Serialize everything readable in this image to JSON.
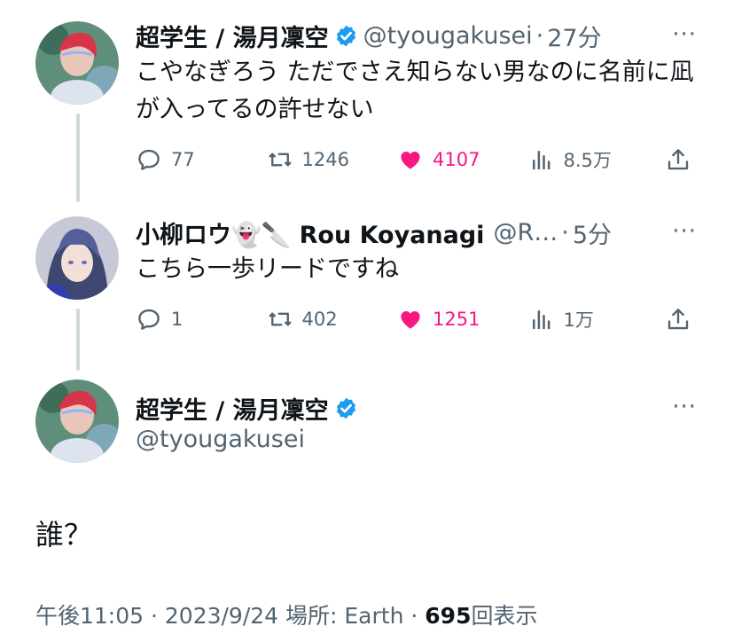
{
  "tweets": [
    {
      "name": "超学生 / 湯月凜空",
      "verified": true,
      "handle": "@tyougakusei",
      "time": "27分",
      "text": "こやなぎろう ただでさえ知らない男なのに名前に凪が入ってるの許せない",
      "replies": "77",
      "retweets": "1246",
      "likes": "4107",
      "views": "8.5万"
    },
    {
      "name": "小柳ロウ👻🔪 Rou Koyanagi",
      "verified": false,
      "handle": "@R…",
      "time": "5分",
      "text": "こちら一歩リードですね",
      "replies": "1",
      "retweets": "402",
      "likes": "1251",
      "views": "1万"
    }
  ],
  "detail": {
    "name": "超学生 / 湯月凜空",
    "verified": true,
    "handle": "@tyougakusei",
    "text": "誰？",
    "footer_time": "午後11:05 · 2023/9/24 場所: Earth · ",
    "views_count": "695",
    "views_label": "回表示"
  },
  "more_label": "···",
  "dot_separator": "·",
  "colors": {
    "like": "#f91880",
    "verified": "#1d9bf0",
    "secondary": "#536471",
    "thread_line": "#cfd9de"
  },
  "icons": [
    "reply-icon",
    "retweet-icon",
    "heart-icon",
    "views-icon",
    "share-icon",
    "verified-badge-icon",
    "more-icon"
  ]
}
